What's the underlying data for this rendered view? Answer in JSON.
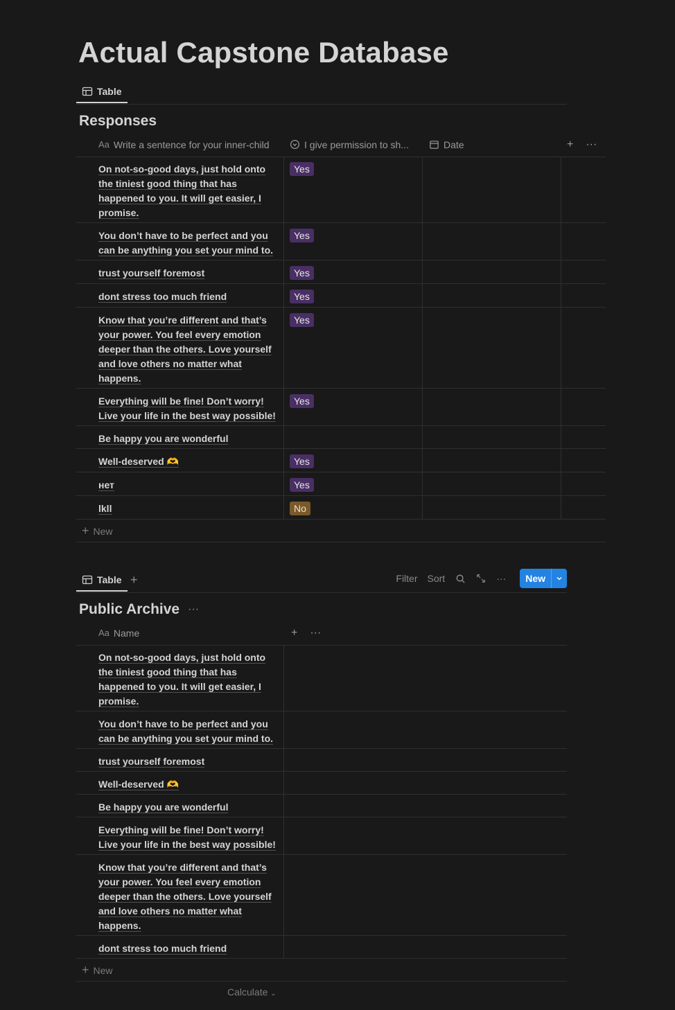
{
  "page": {
    "title": "Actual Capstone Database"
  },
  "responses": {
    "tab_label": "Table",
    "title": "Responses",
    "columns": {
      "col1_prefix": "Aa",
      "col1": "Write a sentence for your inner-child",
      "col2": "I give permission to sh...",
      "col3": "Date"
    },
    "rows": [
      {
        "text": "On not-so-good days, just hold onto the tiniest good thing that has happened to you. It will get easier, I promise.",
        "tag": "Yes"
      },
      {
        "text": "You don’t have to be perfect and you can be anything you set your mind to.",
        "tag": "Yes"
      },
      {
        "text": "trust yourself foremost",
        "tag": "Yes"
      },
      {
        "text": "dont stress too much friend",
        "tag": "Yes"
      },
      {
        "text": "Know that you’re different and that’s your power. You feel every emotion deeper than the others. Love yourself and love others no matter what happens.",
        "tag": "Yes"
      },
      {
        "text": "Everything will be fine! Don’t worry! Live your life in the best way possible!",
        "tag": "Yes"
      },
      {
        "text": "Be happy you are wonderful",
        "tag": ""
      },
      {
        "text": "Well-deserved 🫶",
        "tag": "Yes"
      },
      {
        "text": "нет",
        "tag": "Yes"
      },
      {
        "text": "lkll",
        "tag": "No"
      }
    ],
    "new_label": "New"
  },
  "archive": {
    "tab_label": "Table",
    "toolbar": {
      "filter": "Filter",
      "sort": "Sort",
      "new": "New"
    },
    "title": "Public Archive",
    "columns": {
      "col1_prefix": "Aa",
      "col1": "Name"
    },
    "rows": [
      {
        "text": "On not-so-good days, just hold onto the tiniest good thing that has happened to you. It will get easier, I promise."
      },
      {
        "text": "You don’t have to be perfect and you can be anything you set your mind to."
      },
      {
        "text": "trust yourself foremost"
      },
      {
        "text": "Well-deserved 🫶"
      },
      {
        "text": "Be happy you are wonderful"
      },
      {
        "text": "Everything will be fine! Don’t worry! Live your life in the best way possible!"
      },
      {
        "text": "Know that you’re different and that’s your power. You feel every emotion deeper than the others. Love yourself and love others no matter what happens."
      },
      {
        "text": "dont stress too much friend"
      }
    ],
    "new_label": "New",
    "calculate": "Calculate"
  },
  "colors": {
    "accent": "#2383e2",
    "tag_yes": "#492f64",
    "tag_no": "#7a5a2a"
  }
}
